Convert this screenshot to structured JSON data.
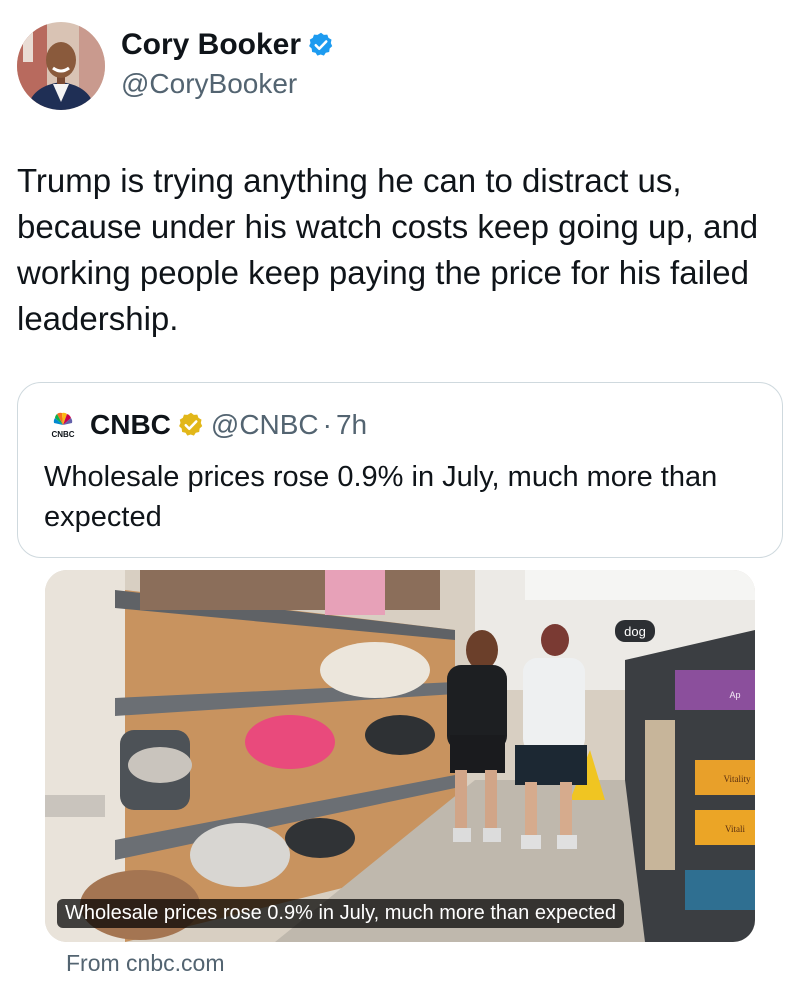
{
  "author": {
    "name": "Cory Booker",
    "handle": "@CoryBooker"
  },
  "tweet": {
    "text": "Trump is trying anything he can to distract us, because under his watch costs keep going up, and working people keep paying the price for his failed leadership."
  },
  "quote": {
    "logo_text": "CNBC",
    "name": "CNBC",
    "handle": "@CNBC",
    "separator": "·",
    "time": "7h",
    "text": "Wholesale prices rose 0.9% in July, much more than expected"
  },
  "media": {
    "scene_sign": "dog",
    "product_labels": [
      "Vitality",
      "Vitali",
      "Ap"
    ],
    "caption": "Wholesale prices rose 0.9% in July, much more than expected"
  },
  "link": {
    "source": "From cnbc.com"
  },
  "colors": {
    "verified_blue": "#1d9bf0",
    "verified_gold": "#e2b719",
    "secondary_text": "#536471",
    "border": "#cfd9de"
  }
}
